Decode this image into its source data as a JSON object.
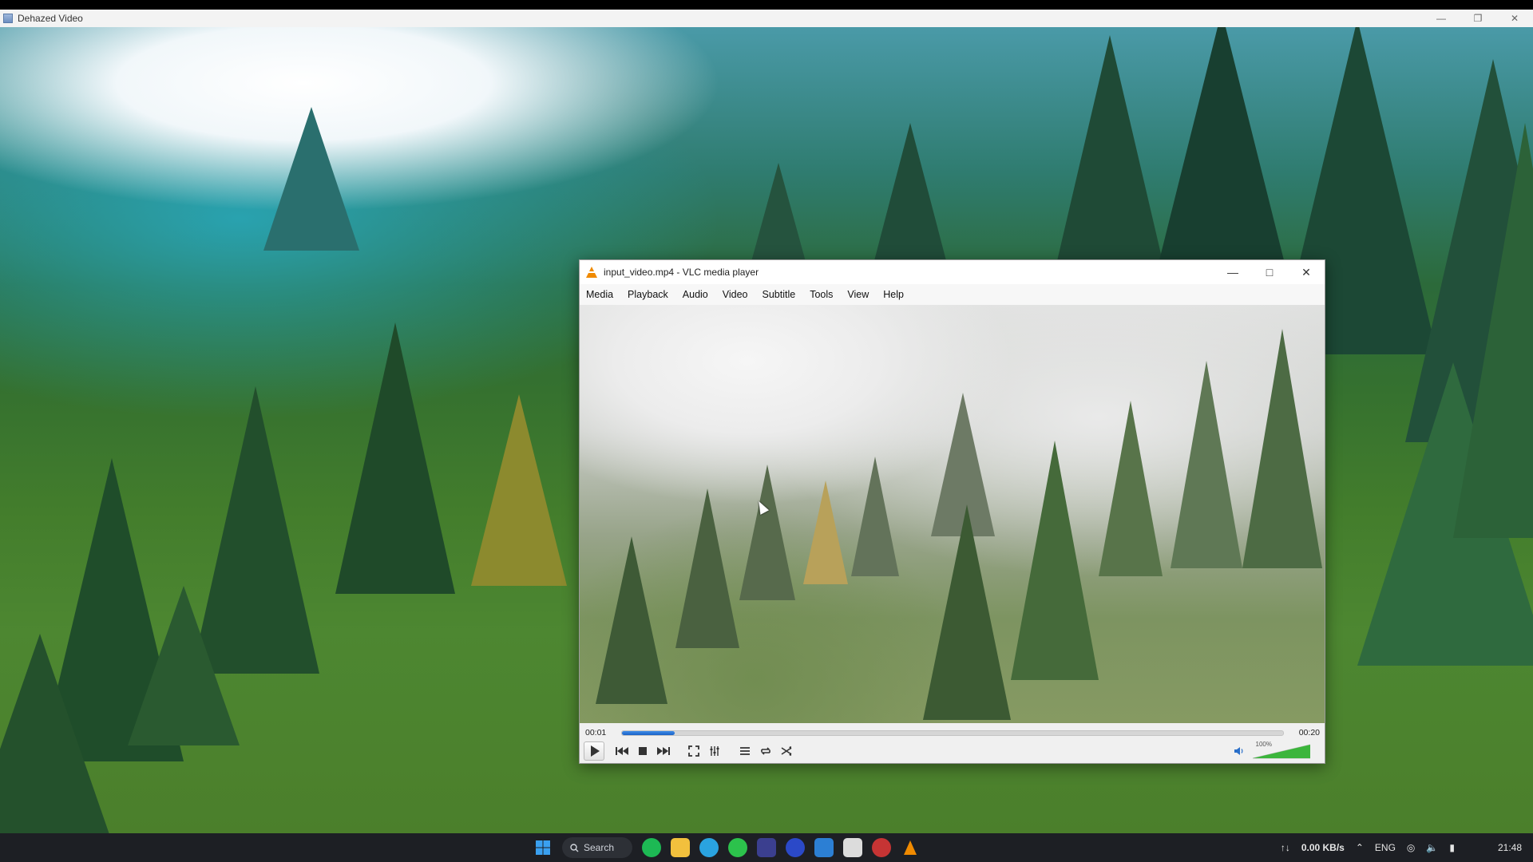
{
  "outer_window": {
    "title": "Dehazed Video",
    "controls": [
      "minimize-icon",
      "restore-icon",
      "close-icon"
    ]
  },
  "vlc": {
    "title": "input_video.mp4 - VLC media player",
    "menu": [
      "Media",
      "Playback",
      "Audio",
      "Video",
      "Subtitle",
      "Tools",
      "View",
      "Help"
    ],
    "time_elapsed": "00:01",
    "time_total": "00:20",
    "progress_fraction": 0.08,
    "volume_label": "100%",
    "volume_fraction": 1.0,
    "colors": {
      "accent": "#1b63c6",
      "cone": "#f08a00",
      "volume": "#3bb53b"
    },
    "control_buttons": [
      "play-icon",
      "previous-icon",
      "stop-icon",
      "next-icon",
      "fullscreen-icon",
      "extended-settings-icon",
      "playlist-icon",
      "loop-icon",
      "shuffle-icon"
    ]
  },
  "taskbar": {
    "search_label": "Search",
    "network_speed": "0.00 KB/s",
    "network_prefix": "↑↓",
    "language": "ENG",
    "clock": "21:48"
  }
}
